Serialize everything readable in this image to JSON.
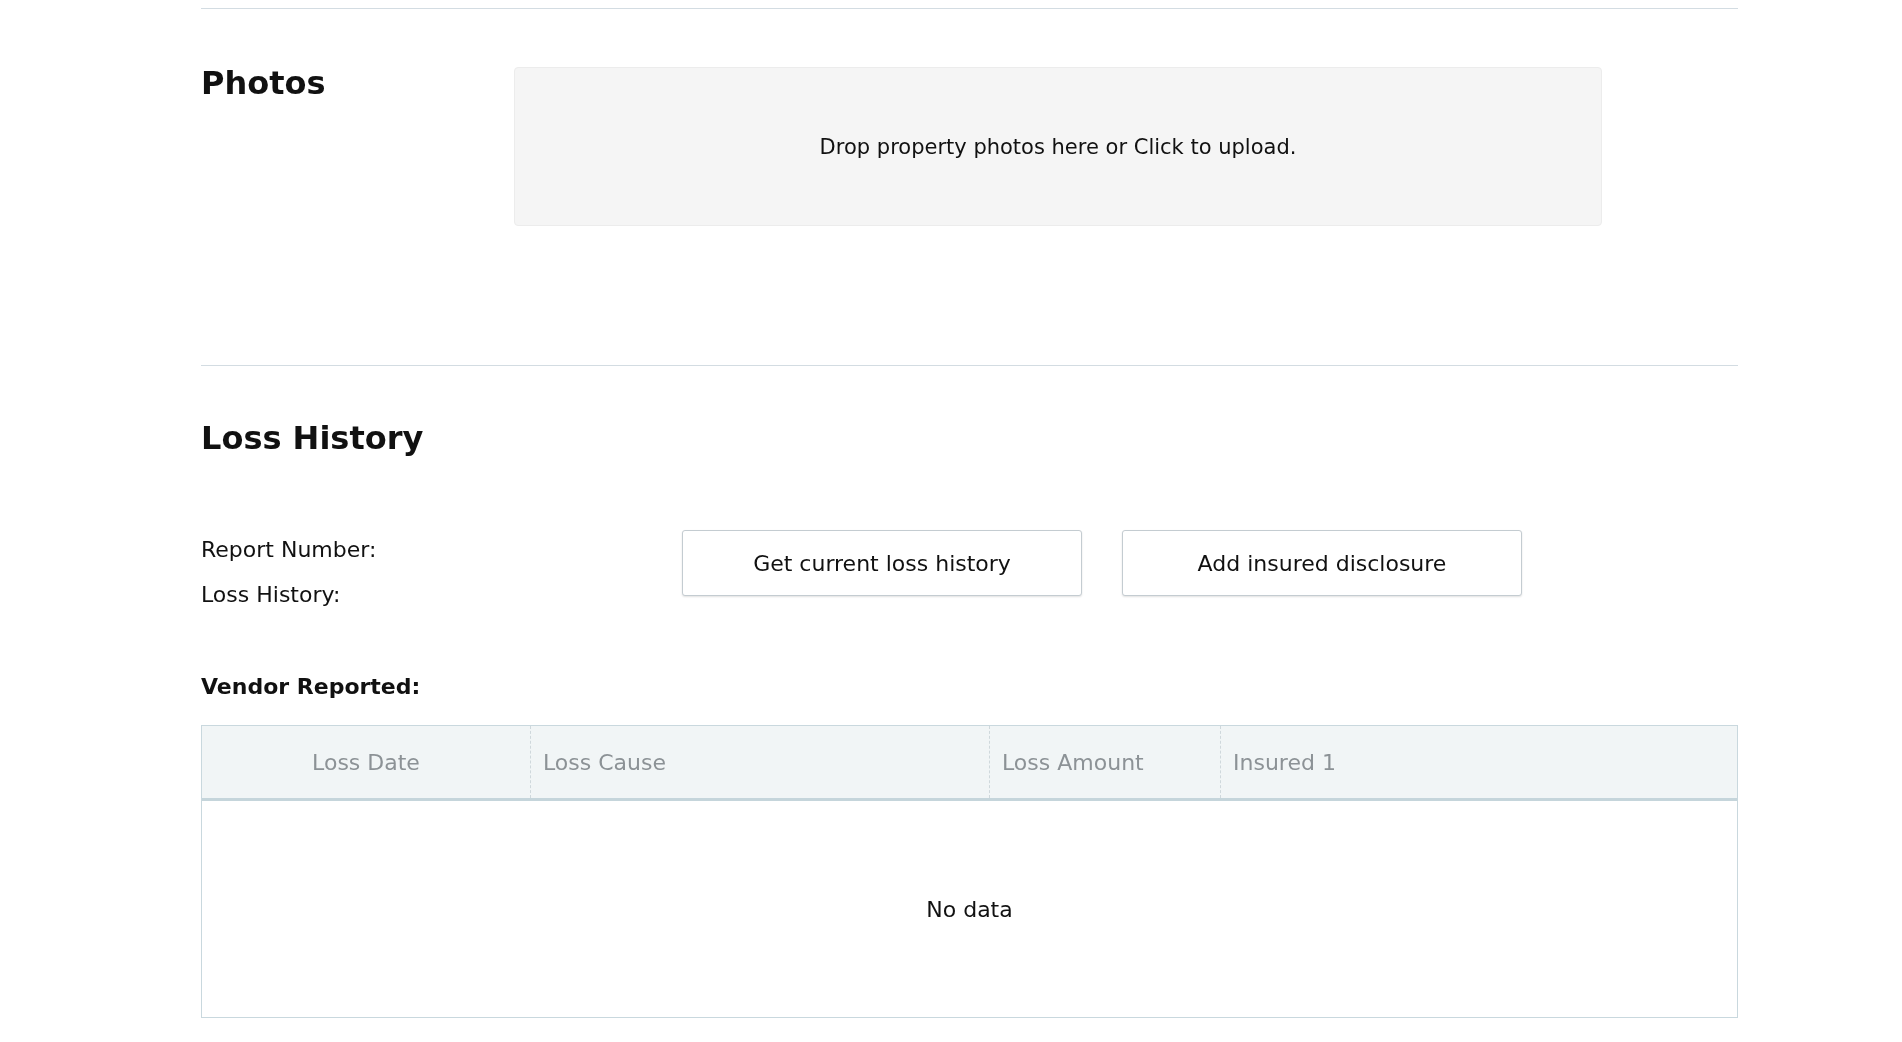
{
  "photos": {
    "title": "Photos",
    "dropzone_text": "Drop property photos here or Click to upload."
  },
  "loss_history": {
    "title": "Loss History",
    "fields": [
      {
        "label": "Report Number:"
      },
      {
        "label": "Loss History:"
      }
    ],
    "buttons": [
      "Get current loss history",
      "Add insured disclosure"
    ],
    "vendor_heading": "Vendor Reported:",
    "table": {
      "columns": [
        {
          "label": "Loss Date"
        },
        {
          "label": "Loss Cause"
        },
        {
          "label": "Loss Amount"
        },
        {
          "label": "Insured 1"
        }
      ],
      "empty_text": "No data"
    }
  }
}
